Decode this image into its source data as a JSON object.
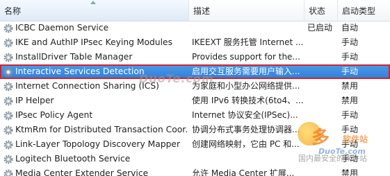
{
  "columns": {
    "name": "名称",
    "description": "描述",
    "status": "状态",
    "startup_type": "启动类型"
  },
  "services": [
    {
      "name": "ICBC Daemon Service",
      "description": "",
      "status": "已启动",
      "startup": "自动"
    },
    {
      "name": "IKE and AuthIP IPsec Keying Modules",
      "description": "IKEEXT 服务托管 Internet ...",
      "status": "",
      "startup": "手动"
    },
    {
      "name": "InstallDriver Table Manager",
      "description": "Provides support for the...",
      "status": "",
      "startup": "手动"
    },
    {
      "name": "Interactive Services Detection",
      "description": "启用交互服务需要用户输入...",
      "status": "",
      "startup": "手动"
    },
    {
      "name": "Internet Connection Sharing (ICS)",
      "description": "为家庭和小型办公网络提供...",
      "status": "",
      "startup": "禁用"
    },
    {
      "name": "IP Helper",
      "description": "使用 IPv6 转换技术(6to4、...",
      "status": "",
      "startup": "禁用"
    },
    {
      "name": "IPsec Policy Agent",
      "description": "Internet 协议安全(IPSec)...",
      "status": "",
      "startup": "手动"
    },
    {
      "name": "KtmRm for Distributed Transaction Coor...",
      "description": "协调分布式事务处理协调器...",
      "status": "",
      "startup": "手动"
    },
    {
      "name": "Link-Layer Topology Discovery Mapper",
      "description": "创建网络映射，它由 PC 和...",
      "status": "",
      "startup": "手动"
    },
    {
      "name": "Logitech Bluetooth Service",
      "description": "",
      "status": "",
      "startup": "手动"
    },
    {
      "name": "Media Center Extender Service",
      "description": "允许 Media Center 扩展...",
      "status": "",
      "startup": "禁用"
    }
  ],
  "selected_index": 3,
  "watermark": {
    "center": "DuoTe.com",
    "logo_main": "多",
    "logo_sub": "软件站",
    "logo_url": "DuoTe.com",
    "logo_tag": "国内最安全的软件站"
  }
}
